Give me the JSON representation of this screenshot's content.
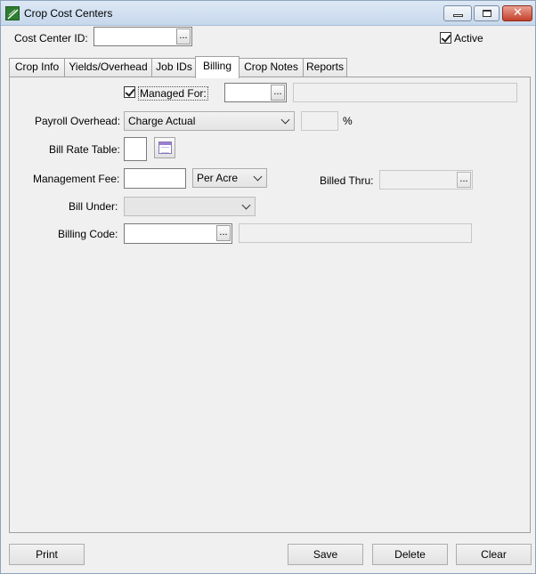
{
  "window": {
    "title": "Crop Cost Centers",
    "close_glyph": "✕",
    "icon": "app-leaf-icon"
  },
  "header": {
    "cost_center_label": "Cost Center  ID:",
    "cost_center_value": "",
    "dots": "...",
    "active_label": "Active",
    "active_checked": true
  },
  "tabs": [
    {
      "label": "Crop Info",
      "active": false
    },
    {
      "label": "Yields/Overhead",
      "active": false
    },
    {
      "label": "Job IDs",
      "active": false
    },
    {
      "label": "Billing",
      "active": true
    },
    {
      "label": "Crop Notes",
      "active": false
    },
    {
      "label": "Reports",
      "active": false
    }
  ],
  "billing": {
    "managed_for_label": "Managed For:",
    "managed_for_checked": true,
    "managed_for_value": "",
    "managed_for_desc": "",
    "payroll_overhead_label": "Payroll Overhead:",
    "payroll_overhead_value": "Charge Actual",
    "percent_value": "",
    "percent_symbol": "%",
    "bill_rate_table_label": "Bill Rate Table:",
    "bill_rate_table_value": "",
    "management_fee_label": "Management Fee:",
    "management_fee_value": "",
    "fee_basis_value": "Per Acre",
    "billed_thru_label": "Billed Thru:",
    "billed_thru_value": "",
    "bill_under_label": "Bill Under:",
    "bill_under_value": "",
    "billing_code_label": "Billing Code:",
    "billing_code_value": "",
    "billing_code_desc": ""
  },
  "footer": {
    "print": "Print",
    "save": "Save",
    "delete": "Delete",
    "clear": "Clear"
  }
}
